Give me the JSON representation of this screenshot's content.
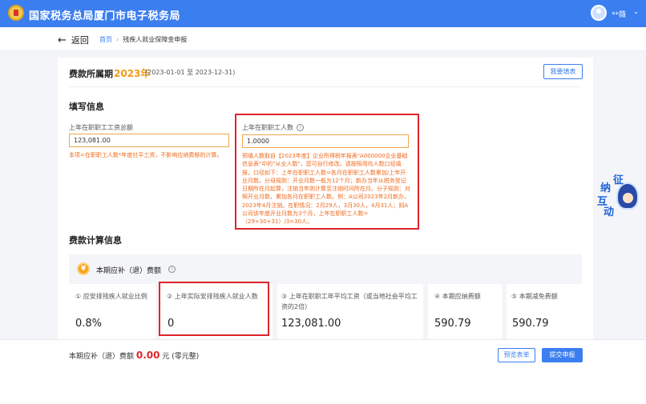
{
  "header": {
    "site_title": "国家税务总局厦门市电子税务局",
    "user_name": "**薇",
    "caret": "⌄"
  },
  "nav": {
    "back_label": "返回",
    "back_arrow": "←",
    "breadcrumb_home": "首页",
    "breadcrumb_sep": "›",
    "breadcrumb_current": "残疾人就业保障金申报"
  },
  "period": {
    "label": "费款所属期",
    "year": "2023年",
    "range": "(2023-01-01 至 2023-12-31)",
    "fill_button": "我要填表"
  },
  "fill_section": {
    "title": "填写信息",
    "total_wage": {
      "label": "上年在职职工工资总额",
      "value": "123,081.00",
      "note": "本项=在职职工人数*年度社平工资，不影响应纳费额的计算。"
    },
    "staff_count": {
      "label": "上年在职职工人数",
      "help": "i",
      "value": "1.0000",
      "note": "预填人数取自【2023年度】企业所得税年报表\"A000000企业基础信息表\"中的\"从业人数\"，您可自行修改。请按照用均人数口径填报，口径如下：上年在职职工人数=各月在职职工人数累加/上年开业月数。分母规则：开业月数一般为12个月；新办当年从税务登记日期所在月起算，注销当年则计算至注销时间所在月。分子规则：对照开业月数，累加各月在职职工人数。例：A公司2023年2月新办，2023年4月注销。在职情况：2月29人，3月30人，4月31人；则A公司该年度开业月数为3个月，上年在职职工人数=（29+30+31）/3=30人。"
    }
  },
  "calc_section": {
    "title": "费款计算信息",
    "coin_symbol": "¥",
    "head": "本期应补（退）费额",
    "help": "i",
    "cards": [
      {
        "label": "① 应安排残疾人就业比例",
        "value": "0.8%"
      },
      {
        "label": "② 上年实际安排残疾人就业人数",
        "value": "0"
      },
      {
        "label": "③ 上年在职职工年平均工资（或当地社会平均工资的2倍）",
        "value": "123,081.00"
      },
      {
        "label": "④ 本期应纳费额",
        "value": "590.79"
      },
      {
        "label": "⑤ 本期减免费额",
        "value": "590.79"
      }
    ]
  },
  "footer": {
    "amount_label": "本期应补（退）费额",
    "amount": "0.00",
    "unit": "元",
    "amount_words": "(零元整)",
    "preview_button": "预览表单",
    "submit_button": "提交申报"
  },
  "widget": {
    "c1": "征",
    "c2": "纳",
    "c3": "互",
    "c4": "动"
  }
}
